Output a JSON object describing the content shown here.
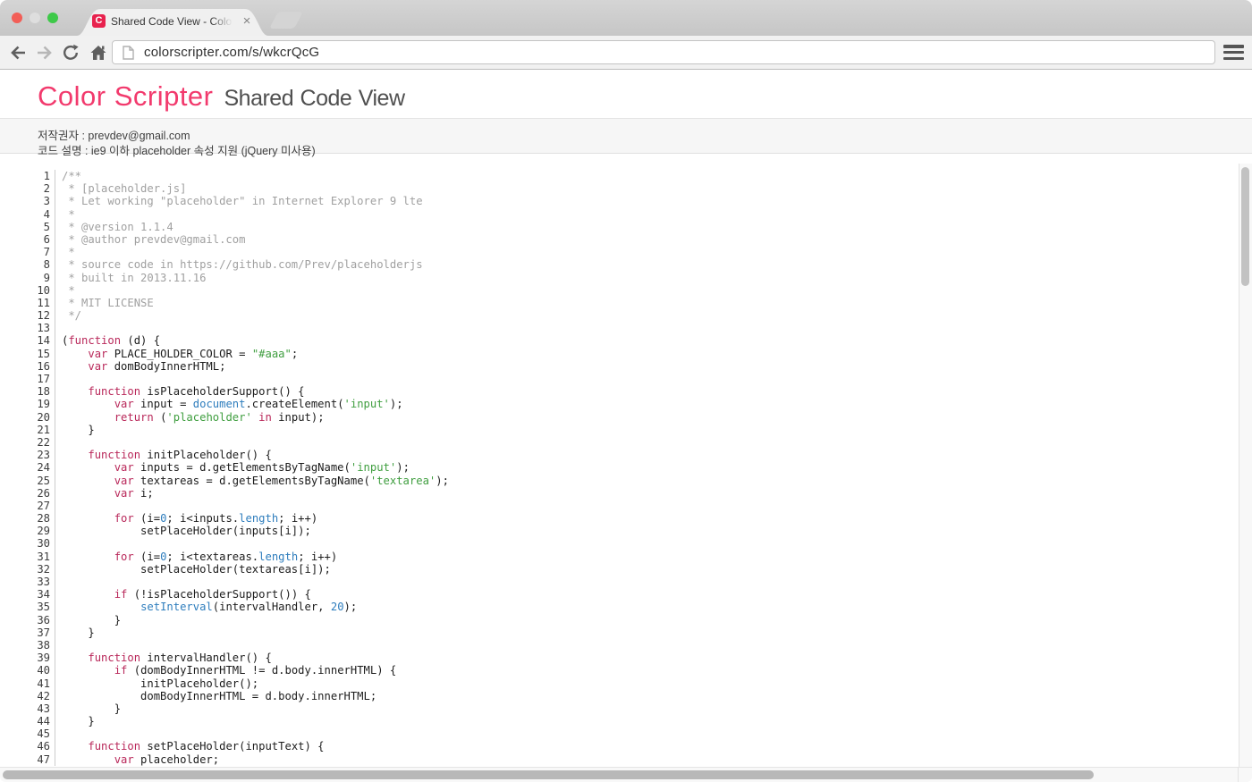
{
  "colors": {
    "keyword": "#b9285a",
    "builtin": "#2e7dbd",
    "string": "#3f9e3f",
    "comment": "#a0a0a0",
    "plain": "#1c1c1c",
    "brand": "#f23a6d",
    "favicon": "#e8224e"
  },
  "browser": {
    "tab_title": "Shared Code View - Color S",
    "favicon_letter": "C",
    "url": "colorscripter.com/s/wkcrQcG",
    "close_glyph": "×"
  },
  "header": {
    "brand": "Color Scripter",
    "subtitle": "Shared Code View"
  },
  "info": {
    "line1": "저작권자 : prevdev@gmail.com",
    "line2": "코드 설명 : ie9 이하 placeholder 속성 지원 (jQuery 미사용)"
  },
  "code": {
    "lines": [
      {
        "n": 1,
        "t": [
          [
            "c",
            "/**"
          ]
        ]
      },
      {
        "n": 2,
        "t": [
          [
            "c",
            " * [placeholder.js]"
          ]
        ]
      },
      {
        "n": 3,
        "t": [
          [
            "c",
            " * Let working \"placeholder\" in Internet Explorer 9 lte"
          ]
        ]
      },
      {
        "n": 4,
        "t": [
          [
            "c",
            " *"
          ]
        ]
      },
      {
        "n": 5,
        "t": [
          [
            "c",
            " * @version 1.1.4"
          ]
        ]
      },
      {
        "n": 6,
        "t": [
          [
            "c",
            " * @author prevdev@gmail.com"
          ]
        ]
      },
      {
        "n": 7,
        "t": [
          [
            "c",
            " *"
          ]
        ]
      },
      {
        "n": 8,
        "t": [
          [
            "c",
            " * source code in https://github.com/Prev/placeholderjs"
          ]
        ]
      },
      {
        "n": 9,
        "t": [
          [
            "c",
            " * built in 2013.11.16"
          ]
        ]
      },
      {
        "n": 10,
        "t": [
          [
            "c",
            " *"
          ]
        ]
      },
      {
        "n": 11,
        "t": [
          [
            "c",
            " * MIT LICENSE"
          ]
        ]
      },
      {
        "n": 12,
        "t": [
          [
            "c",
            " */"
          ]
        ]
      },
      {
        "n": 13,
        "t": []
      },
      {
        "n": 14,
        "t": [
          [
            "p",
            "("
          ],
          [
            "k",
            "function"
          ],
          [
            "p",
            " (d) {"
          ]
        ]
      },
      {
        "n": 15,
        "t": [
          [
            "p",
            "    "
          ],
          [
            "k",
            "var"
          ],
          [
            "p",
            " PLACE_HOLDER_COLOR = "
          ],
          [
            "s",
            "\"#aaa\""
          ],
          [
            "p",
            ";"
          ]
        ]
      },
      {
        "n": 16,
        "t": [
          [
            "p",
            "    "
          ],
          [
            "k",
            "var"
          ],
          [
            "p",
            " domBodyInnerHTML;"
          ]
        ]
      },
      {
        "n": 17,
        "t": []
      },
      {
        "n": 18,
        "t": [
          [
            "p",
            "    "
          ],
          [
            "k",
            "function"
          ],
          [
            "p",
            " isPlaceholderSupport() {"
          ]
        ]
      },
      {
        "n": 19,
        "t": [
          [
            "p",
            "        "
          ],
          [
            "k",
            "var"
          ],
          [
            "p",
            " input = "
          ],
          [
            "b",
            "document"
          ],
          [
            "p",
            ".createElement("
          ],
          [
            "s",
            "'input'"
          ],
          [
            "p",
            ");"
          ]
        ]
      },
      {
        "n": 20,
        "t": [
          [
            "p",
            "        "
          ],
          [
            "k",
            "return"
          ],
          [
            "p",
            " ("
          ],
          [
            "s",
            "'placeholder'"
          ],
          [
            "p",
            " "
          ],
          [
            "k",
            "in"
          ],
          [
            "p",
            " input);"
          ]
        ]
      },
      {
        "n": 21,
        "t": [
          [
            "p",
            "    }"
          ]
        ]
      },
      {
        "n": 22,
        "t": []
      },
      {
        "n": 23,
        "t": [
          [
            "p",
            "    "
          ],
          [
            "k",
            "function"
          ],
          [
            "p",
            " initPlaceholder() {"
          ]
        ]
      },
      {
        "n": 24,
        "t": [
          [
            "p",
            "        "
          ],
          [
            "k",
            "var"
          ],
          [
            "p",
            " inputs = d.getElementsByTagName("
          ],
          [
            "s",
            "'input'"
          ],
          [
            "p",
            ");"
          ]
        ]
      },
      {
        "n": 25,
        "t": [
          [
            "p",
            "        "
          ],
          [
            "k",
            "var"
          ],
          [
            "p",
            " textareas = d.getElementsByTagName("
          ],
          [
            "s",
            "'textarea'"
          ],
          [
            "p",
            ");"
          ]
        ]
      },
      {
        "n": 26,
        "t": [
          [
            "p",
            "        "
          ],
          [
            "k",
            "var"
          ],
          [
            "p",
            " i;"
          ]
        ]
      },
      {
        "n": 27,
        "t": []
      },
      {
        "n": 28,
        "t": [
          [
            "p",
            "        "
          ],
          [
            "k",
            "for"
          ],
          [
            "p",
            " (i="
          ],
          [
            "b",
            "0"
          ],
          [
            "p",
            "; i<inputs."
          ],
          [
            "b",
            "length"
          ],
          [
            "p",
            "; i++)"
          ]
        ]
      },
      {
        "n": 29,
        "t": [
          [
            "p",
            "            setPlaceHolder(inputs[i]);"
          ]
        ]
      },
      {
        "n": 30,
        "t": []
      },
      {
        "n": 31,
        "t": [
          [
            "p",
            "        "
          ],
          [
            "k",
            "for"
          ],
          [
            "p",
            " (i="
          ],
          [
            "b",
            "0"
          ],
          [
            "p",
            "; i<textareas."
          ],
          [
            "b",
            "length"
          ],
          [
            "p",
            "; i++)"
          ]
        ]
      },
      {
        "n": 32,
        "t": [
          [
            "p",
            "            setPlaceHolder(textareas[i]);"
          ]
        ]
      },
      {
        "n": 33,
        "t": []
      },
      {
        "n": 34,
        "t": [
          [
            "p",
            "        "
          ],
          [
            "k",
            "if"
          ],
          [
            "p",
            " (!isPlaceholderSupport()) {"
          ]
        ]
      },
      {
        "n": 35,
        "t": [
          [
            "p",
            "            "
          ],
          [
            "b",
            "setInterval"
          ],
          [
            "p",
            "(intervalHandler, "
          ],
          [
            "b",
            "20"
          ],
          [
            "p",
            ");"
          ]
        ]
      },
      {
        "n": 36,
        "t": [
          [
            "p",
            "        }"
          ]
        ]
      },
      {
        "n": 37,
        "t": [
          [
            "p",
            "    }"
          ]
        ]
      },
      {
        "n": 38,
        "t": []
      },
      {
        "n": 39,
        "t": [
          [
            "p",
            "    "
          ],
          [
            "k",
            "function"
          ],
          [
            "p",
            " intervalHandler() {"
          ]
        ]
      },
      {
        "n": 40,
        "t": [
          [
            "p",
            "        "
          ],
          [
            "k",
            "if"
          ],
          [
            "p",
            " (domBodyInnerHTML != d.body.innerHTML) {"
          ]
        ]
      },
      {
        "n": 41,
        "t": [
          [
            "p",
            "            initPlaceholder();"
          ]
        ]
      },
      {
        "n": 42,
        "t": [
          [
            "p",
            "            domBodyInnerHTML = d.body.innerHTML;"
          ]
        ]
      },
      {
        "n": 43,
        "t": [
          [
            "p",
            "        }"
          ]
        ]
      },
      {
        "n": 44,
        "t": [
          [
            "p",
            "    }"
          ]
        ]
      },
      {
        "n": 45,
        "t": []
      },
      {
        "n": 46,
        "t": [
          [
            "p",
            "    "
          ],
          [
            "k",
            "function"
          ],
          [
            "p",
            " setPlaceHolder(inputText) {"
          ]
        ]
      },
      {
        "n": 47,
        "t": [
          [
            "p",
            "        "
          ],
          [
            "k",
            "var"
          ],
          [
            "p",
            " placeholder;"
          ]
        ]
      }
    ]
  }
}
